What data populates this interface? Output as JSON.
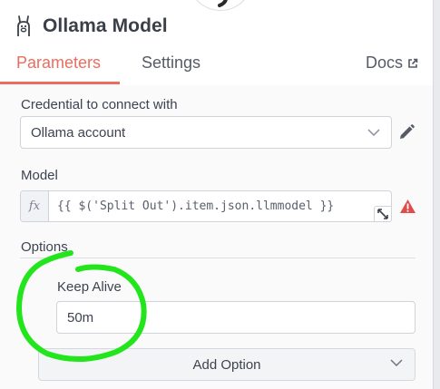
{
  "node": {
    "title": "Ollama Model",
    "icon": "llama-icon",
    "header_icon": "link-icon"
  },
  "tabs": [
    {
      "label": "Parameters",
      "active": true
    },
    {
      "label": "Settings",
      "active": false
    }
  ],
  "docs": {
    "label": "Docs",
    "icon": "external-link-icon"
  },
  "credential": {
    "label": "Credential to connect with",
    "value": "Ollama account",
    "edit_icon": "pencil-icon"
  },
  "model": {
    "label": "Model",
    "fx": "fx",
    "expression": "{{ $('Split Out').item.json.llmmodel }}",
    "warning_icon": "warning-icon"
  },
  "options": {
    "label": "Options",
    "keep_alive_label": "Keep Alive",
    "keep_alive_value": "50m",
    "add_option_label": "Add Option"
  },
  "colors": {
    "accent": "#ea6d5f",
    "warning": "#e04b4b",
    "annotation": "#22e51c"
  }
}
